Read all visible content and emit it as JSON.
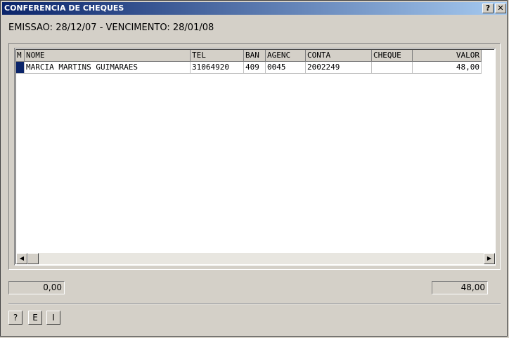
{
  "window": {
    "title": "CONFERENCIA DE CHEQUES",
    "help_label": "?",
    "close_label": "✕"
  },
  "header_text": "EMISSAO: 28/12/07 - VENCIMENTO: 28/01/08",
  "table": {
    "columns": [
      "M",
      "NOME",
      "TEL",
      "BAN",
      "AGENC",
      "CONTA",
      "CHEQUE",
      "VALOR"
    ],
    "rows": [
      [
        "",
        "MARCIA  MARTINS GUIMARAES",
        "31064920",
        "409",
        "0045",
        "2002249",
        "",
        "48,00"
      ]
    ]
  },
  "scrollbar": {
    "left_arrow": "◀",
    "right_arrow": "▶"
  },
  "totals": {
    "left": "0,00",
    "right": "48,00"
  },
  "footer_buttons": [
    "?",
    "E",
    "I"
  ],
  "colors": {
    "title_start": "#0a246a",
    "title_end": "#a6caf0",
    "row_indicator": "#0a246a",
    "face": "#d4d0c8"
  }
}
